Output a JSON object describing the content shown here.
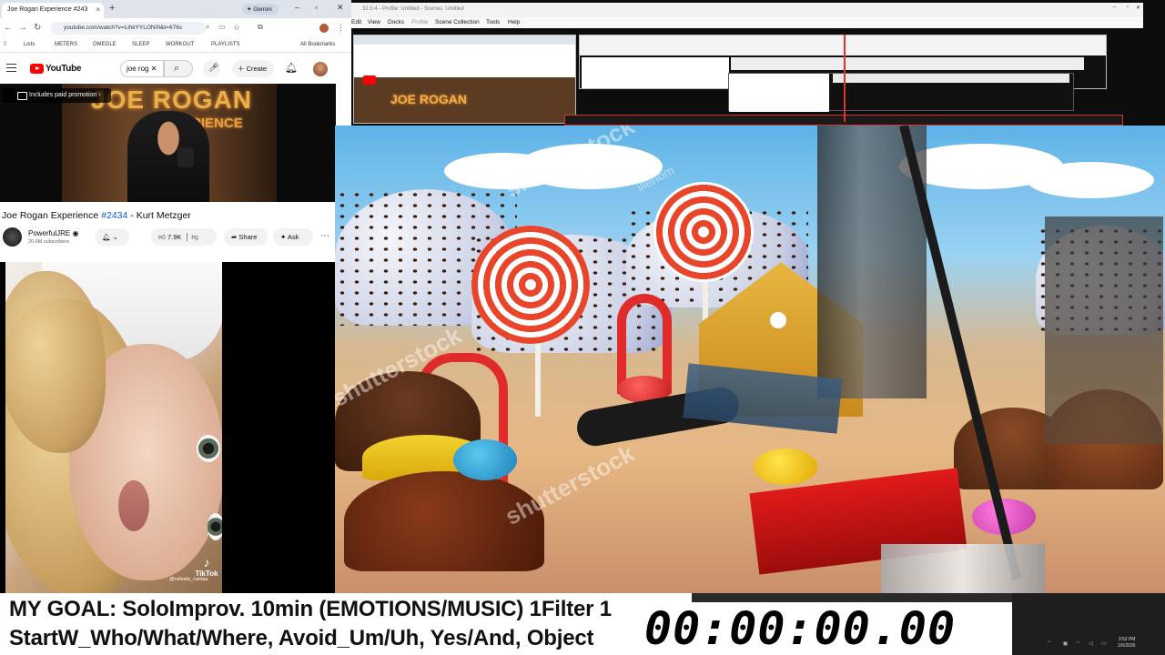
{
  "browser": {
    "tab_title": "Joe Rogan Experience #243",
    "tab_gemini": "Gemini",
    "url": "youtube.com/watch?v=LlhkYYLON0I&t=676s",
    "bookmarks": [
      "Lists",
      "METERS",
      "OMEGLE",
      "SLEEP",
      "WORKOUT",
      "PLAYLISTS",
      "All Bookmarks"
    ]
  },
  "youtube": {
    "logo_text": "YouTube",
    "search_value": "joe rog",
    "create_label": "Create",
    "paid_promo": "Includes paid promotion",
    "video_title_prefix": "Joe Rogan Experience ",
    "video_title_tag": "#2434",
    "video_title_suffix": " - Kurt Metzger",
    "channel_name": "PowerfulJRE",
    "subscribers": "20.6M subscribers",
    "likes": "7.9K",
    "share_label": "Share",
    "ask_label": "Ask"
  },
  "obs": {
    "title": "32.0.4 - Profile: Untitled - Scenes: Untitled",
    "menu": [
      "Edit",
      "View",
      "Docks",
      "Profile",
      "Scene Collection",
      "Tools",
      "Help"
    ]
  },
  "stream_video": {
    "watermarks": [
      "shutterstock",
      "shutterstock",
      "shutterstock",
      "illeriom"
    ]
  },
  "tiktok": {
    "brand": "TikTok",
    "username": "@celeste_campa"
  },
  "overlay": {
    "goal_line1": "MY GOAL: SoloImprov. 10min (EMOTIONS/MUSIC) 1Filter 1",
    "goal_line2": "StartW_Who/What/Where, Avoid_Um/Uh, Yes/And, Object",
    "timer": "00:00:00.00"
  },
  "taskbar": {
    "time": "3:52 PM",
    "date": "1/6/2026"
  }
}
